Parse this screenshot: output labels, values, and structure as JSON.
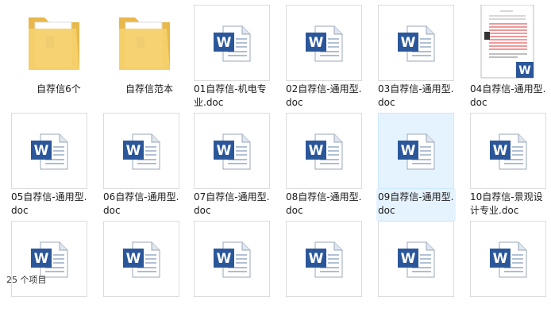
{
  "folders": [
    {
      "label": "自荐信6个"
    },
    {
      "label": "自荐信范本"
    }
  ],
  "row1_docs": [
    {
      "label": "01自荐信-机电专业.doc"
    },
    {
      "label": "02自荐信-通用型.doc"
    },
    {
      "label": "03自荐信-通用型.doc"
    },
    {
      "label": "04自荐信-通用型.doc"
    }
  ],
  "row2_docs": [
    {
      "label": "05自荐信-通用型.doc"
    },
    {
      "label": "06自荐信-通用型.doc"
    },
    {
      "label": "07自荐信-通用型.doc"
    },
    {
      "label": "08自荐信-通用型.doc"
    },
    {
      "label": "09自荐信-通用型.doc"
    },
    {
      "label": "10自荐信-景观设计专业.doc"
    }
  ],
  "status_bar": {
    "item_count": "25 个项目"
  },
  "colors": {
    "selection": "#e5f3ff",
    "word_blue": "#2b579a",
    "folder": "#f6d06a"
  },
  "icons": {
    "folder": "folder-icon",
    "word": "word-doc-icon",
    "preview": "document-preview-icon"
  }
}
